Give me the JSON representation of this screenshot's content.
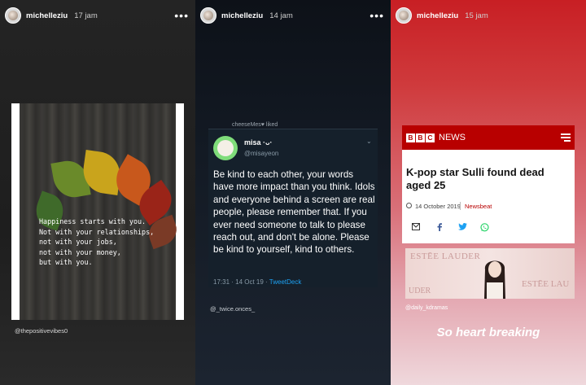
{
  "stories": [
    {
      "username": "michelleziu",
      "time": "17 jam",
      "menu": "•••",
      "quote": [
        "Happiness starts with you.",
        "Not with your relationships,",
        "not with your jobs,",
        "not with your money,",
        "but with you."
      ],
      "credit": "@thepositivevibes0"
    },
    {
      "username": "michelleziu",
      "time": "14 jam",
      "menu": "•••",
      "retweet_label": "cheeseMes♥ liked",
      "tweet": {
        "name": "misa ·ᴗ·",
        "handle": "@misayeon",
        "text": "Be kind to each other, your words have more impact than you think. Idols and everyone behind a screen are real people, please remember that. If you ever need someone to talk to please reach out, and don't be alone. Please be kind to yourself, kind to others.",
        "time": "17:31 · 14 Oct 19 ·",
        "source": "TweetDeck"
      },
      "credit": "@_twice.onces_"
    },
    {
      "username": "michelleziu",
      "time": "15 jam",
      "menu": "•••",
      "news": {
        "brand_letters": [
          "B",
          "B",
          "C"
        ],
        "brand_word": "NEWS",
        "headline": "K-pop star Sulli found dead aged 25",
        "date": "14 October 2019",
        "tag": "Newsbeat",
        "share_icons": [
          "email-icon",
          "facebook-icon",
          "twitter-icon",
          "whatsapp-icon"
        ]
      },
      "photo_text": [
        "ESTĒE LAUDER",
        "ESTĒE LAU",
        "UDER"
      ],
      "credit": "@daily_kdramas",
      "caption": "So heart breaking"
    }
  ],
  "colors": {
    "bbc_red": "#b80000",
    "twitter_blue": "#1da1f2",
    "twitter_bg": "#15202b",
    "whatsapp_green": "#25d366"
  }
}
